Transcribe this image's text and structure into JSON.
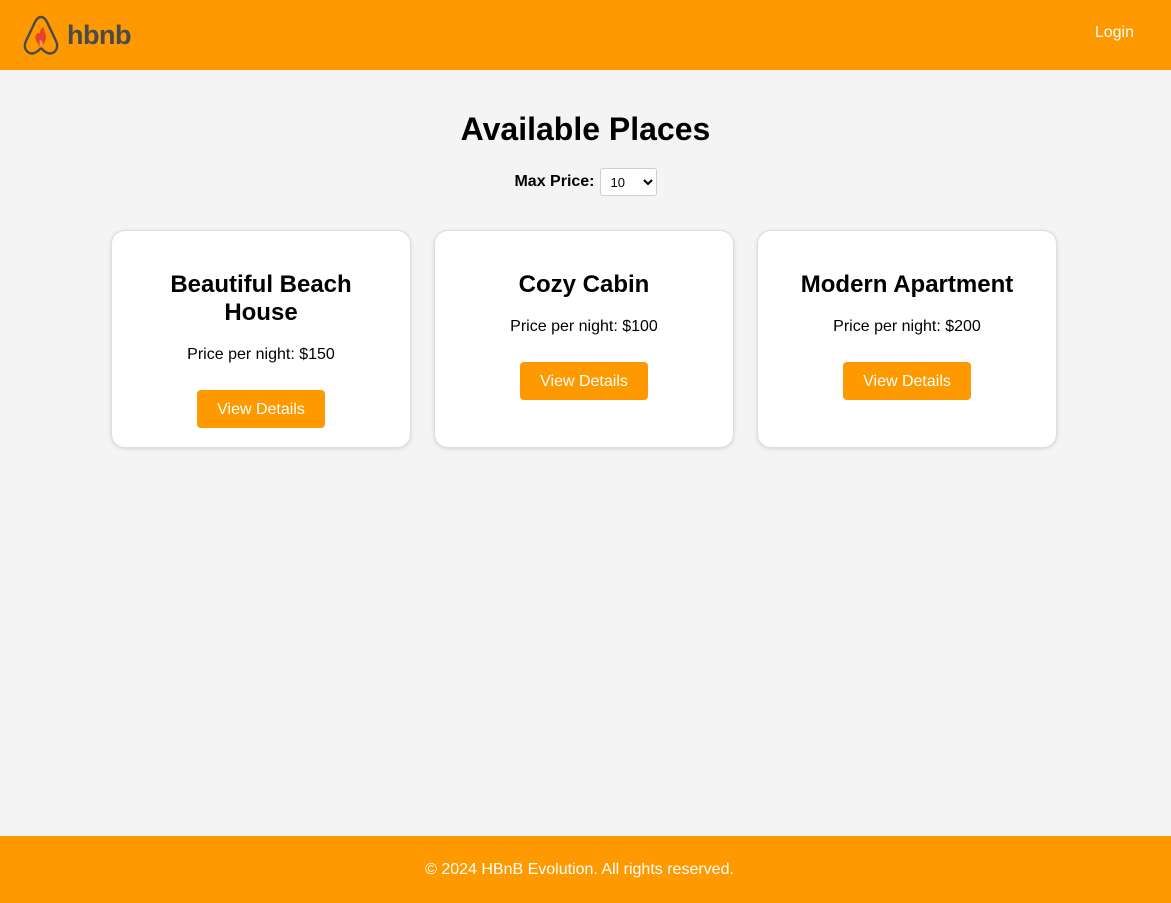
{
  "header": {
    "logo_text": "hbnb",
    "login_label": "Login",
    "logo_icon": "airbnb-style-logo-icon"
  },
  "main": {
    "title": "Available Places",
    "filter": {
      "label": "Max Price:",
      "selected": "10"
    },
    "places": [
      {
        "name": "Beautiful Beach House",
        "price_text": "Price per night: $150",
        "button_label": "View Details"
      },
      {
        "name": "Cozy Cabin",
        "price_text": "Price per night: $100",
        "button_label": "View Details"
      },
      {
        "name": "Modern Apartment",
        "price_text": "Price per night: $200",
        "button_label": "View Details"
      }
    ]
  },
  "footer": {
    "text": "© 2024 HBnB Evolution. All rights reserved."
  },
  "colors": {
    "accent": "#ff9900",
    "background": "#f4f4f4",
    "logo_text": "#4a4a4a",
    "logo_flame": "#e8412c"
  }
}
